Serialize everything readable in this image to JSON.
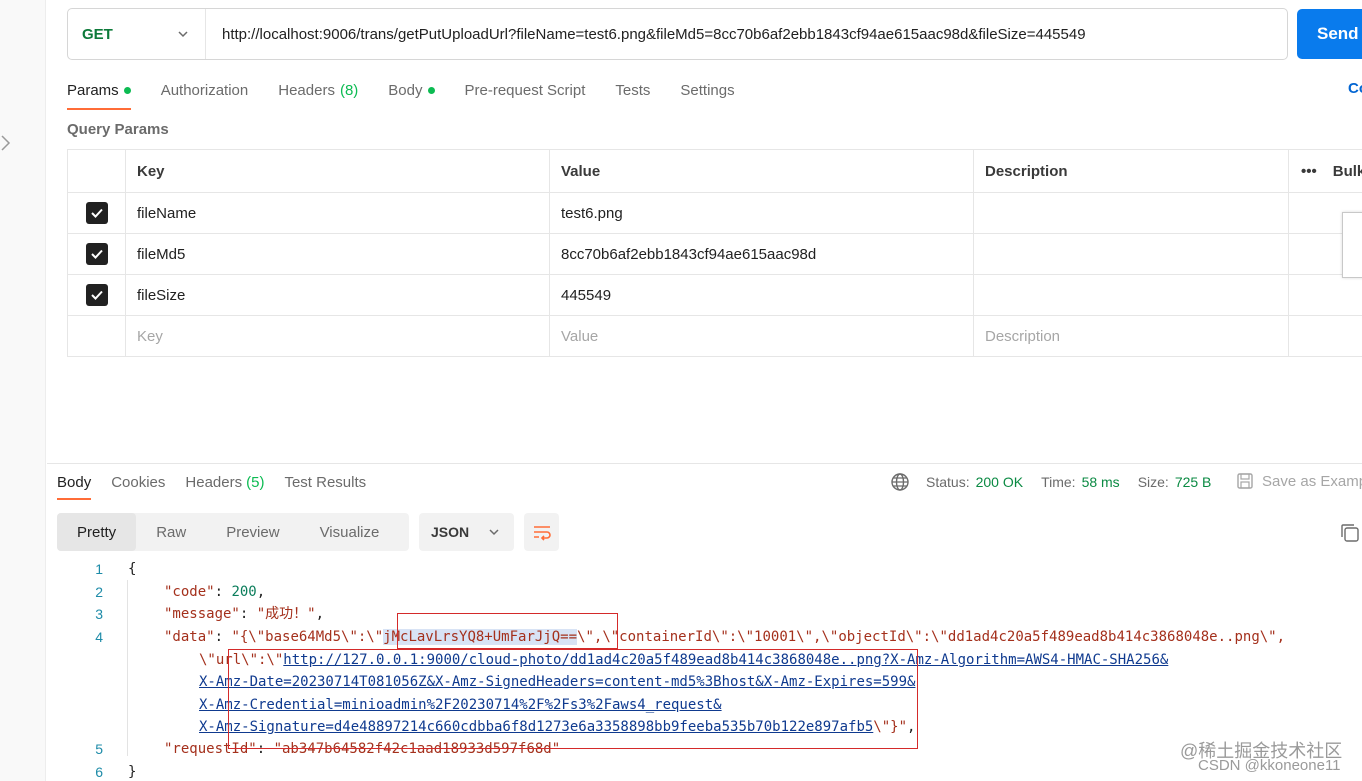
{
  "request": {
    "method": "GET",
    "url": "http://localhost:9006/trans/getPutUploadUrl?fileName=test6.png&fileMd5=8cc70b6af2ebb1843cf94ae615aac98d&fileSize=445549",
    "send_label": "Send"
  },
  "request_tabs": [
    {
      "label": "Params",
      "dot": true,
      "active": true
    },
    {
      "label": "Authorization"
    },
    {
      "label": "Headers",
      "count": "(8)"
    },
    {
      "label": "Body",
      "dot": true
    },
    {
      "label": "Pre-request Script"
    },
    {
      "label": "Tests"
    },
    {
      "label": "Settings"
    }
  ],
  "cookies_label": "Co",
  "query_params": {
    "title": "Query Params",
    "headers": {
      "key": "Key",
      "value": "Value",
      "description": "Description",
      "bulk": "Bulk"
    },
    "rows": [
      {
        "key": "fileName",
        "value": "test6.png",
        "checked": true
      },
      {
        "key": "fileMd5",
        "value": "8cc70b6af2ebb1843cf94ae615aac98d",
        "checked": true
      },
      {
        "key": "fileSize",
        "value": "445549",
        "checked": true
      }
    ],
    "placeholders": {
      "key": "Key",
      "value": "Value",
      "description": "Description"
    }
  },
  "response_tabs": [
    {
      "label": "Body",
      "active": true
    },
    {
      "label": "Cookies"
    },
    {
      "label": "Headers",
      "count": "(5)"
    },
    {
      "label": "Test Results"
    }
  ],
  "status": {
    "status_label": "Status:",
    "status_value": "200 OK",
    "time_label": "Time:",
    "time_value": "58 ms",
    "size_label": "Size:",
    "size_value": "725 B",
    "save_example": "Save as Examp"
  },
  "view_modes": [
    "Pretty",
    "Raw",
    "Preview",
    "Visualize"
  ],
  "format": "JSON",
  "code_lines": {
    "l1": {
      "num": "1",
      "text": "{"
    },
    "l2": {
      "num": "2",
      "key": "\"code\"",
      "sep": ": ",
      "val": "200",
      "tail": ","
    },
    "l3": {
      "num": "3",
      "key": "\"message\"",
      "sep": ": ",
      "val": "\"成功！\"",
      "tail": ","
    },
    "l4": {
      "num": "4",
      "key": "\"data\"",
      "sep": ": ",
      "pre": "\"{\\\"base64Md5\\\":\\\"",
      "sel": "jMcLavLrsYQ8+UmFarJjQ==",
      "post": "\\\",\\\"containerId\\\":\\\"10001\\\",\\\"objectId\\\":\\\"dd1ad4c20a5f489ead8b414c3868048e..png\\\","
    },
    "l4b": {
      "pre": "\\\"url\\\":\\\"",
      "link": "http://127.0.0.1:9000/cloud-photo/dd1ad4c20a5f489ead8b414c3868048e..png?X-Amz-Algorithm=AWS4-HMAC-SHA256&"
    },
    "l4c": {
      "link": "X-Amz-Date=20230714T081056Z&X-Amz-SignedHeaders=content-md5%3Bhost&X-Amz-Expires=599&"
    },
    "l4d": {
      "link": "X-Amz-Credential=minioadmin%2F20230714%2F%2Fs3%2Faws4_request&"
    },
    "l4e": {
      "link": "X-Amz-Signature=d4e48897214c660cdbba6f8d1273e6a3358898bb9feeba535b70b122e897afb5",
      "post": "\\\"}\"",
      "tail": ","
    },
    "l5": {
      "num": "5",
      "key": "\"requestId\"",
      "sep": ": ",
      "val": "\"ab347b64582f42c1aad18933d597f68d\""
    },
    "l6": {
      "num": "6",
      "text": "}"
    }
  },
  "watermark": {
    "line1": "@稀土掘金技术社区",
    "line2": "CSDN @kkoneone11"
  }
}
